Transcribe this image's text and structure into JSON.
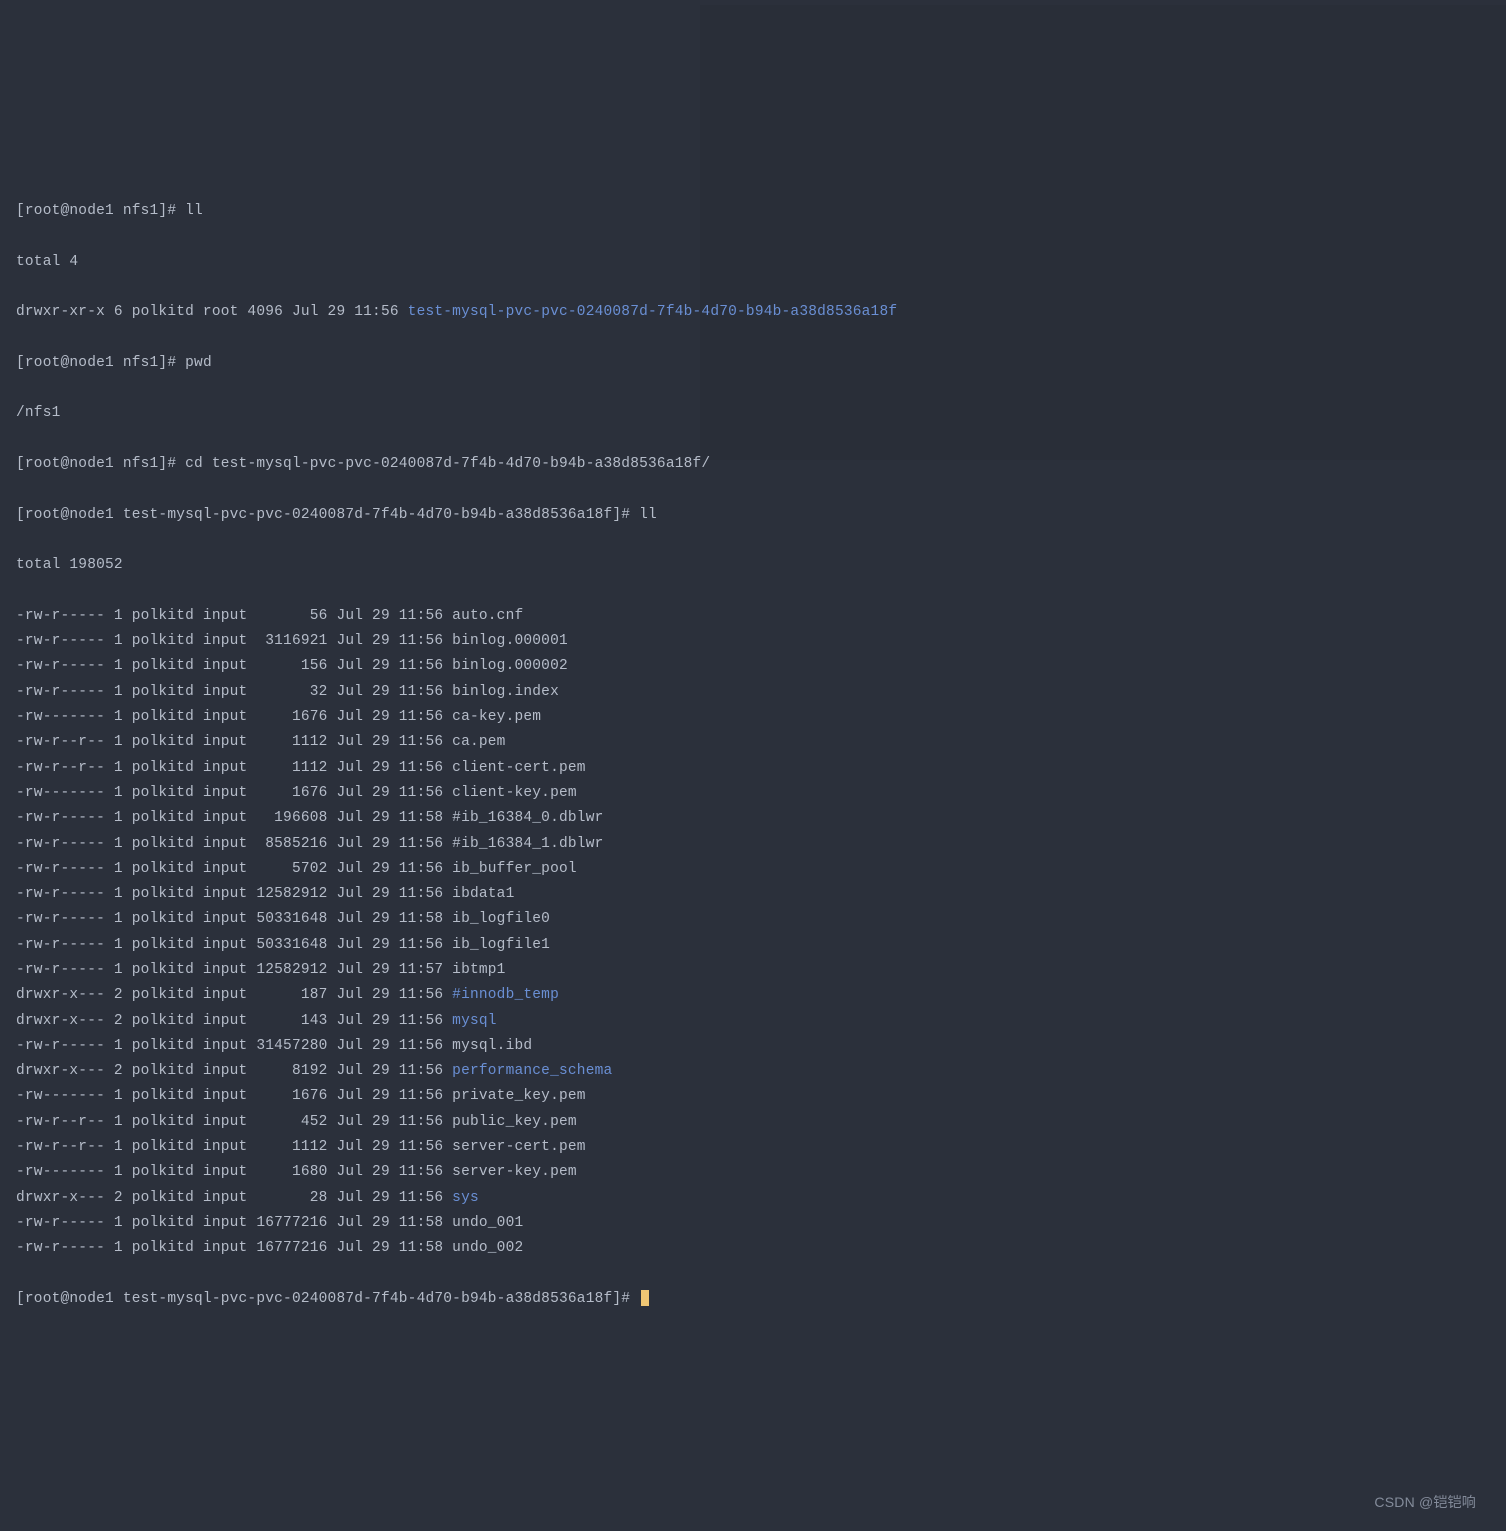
{
  "prompts": {
    "p1": "[root@node1 nfs1]# ",
    "p2": "[root@node1 test-mysql-pvc-pvc-0240087d-7f4b-4d70-b94b-a38d8536a18f]# "
  },
  "cmds": {
    "ll": "ll",
    "pwd": "pwd",
    "cd": "cd test-mysql-pvc-pvc-0240087d-7f4b-4d70-b94b-a38d8536a18f/"
  },
  "out": {
    "total1": "total 4",
    "pwd_out": "/nfs1",
    "total2": "total 198052",
    "dir1_prefix": "drwxr-xr-x 6 polkitd root 4096 Jul 29 11:56 ",
    "dir1_name": "test-mysql-pvc-pvc-0240087d-7f4b-4d70-b94b-a38d8536a18f"
  },
  "files": [
    {
      "perm": "-rw-r-----",
      "links": "1",
      "owner": "polkitd",
      "group": "input",
      "size": "56",
      "date": "Jul 29 11:56",
      "name": "auto.cnf",
      "dir": false
    },
    {
      "perm": "-rw-r-----",
      "links": "1",
      "owner": "polkitd",
      "group": "input",
      "size": "3116921",
      "date": "Jul 29 11:56",
      "name": "binlog.000001",
      "dir": false
    },
    {
      "perm": "-rw-r-----",
      "links": "1",
      "owner": "polkitd",
      "group": "input",
      "size": "156",
      "date": "Jul 29 11:56",
      "name": "binlog.000002",
      "dir": false
    },
    {
      "perm": "-rw-r-----",
      "links": "1",
      "owner": "polkitd",
      "group": "input",
      "size": "32",
      "date": "Jul 29 11:56",
      "name": "binlog.index",
      "dir": false
    },
    {
      "perm": "-rw-------",
      "links": "1",
      "owner": "polkitd",
      "group": "input",
      "size": "1676",
      "date": "Jul 29 11:56",
      "name": "ca-key.pem",
      "dir": false
    },
    {
      "perm": "-rw-r--r--",
      "links": "1",
      "owner": "polkitd",
      "group": "input",
      "size": "1112",
      "date": "Jul 29 11:56",
      "name": "ca.pem",
      "dir": false
    },
    {
      "perm": "-rw-r--r--",
      "links": "1",
      "owner": "polkitd",
      "group": "input",
      "size": "1112",
      "date": "Jul 29 11:56",
      "name": "client-cert.pem",
      "dir": false
    },
    {
      "perm": "-rw-------",
      "links": "1",
      "owner": "polkitd",
      "group": "input",
      "size": "1676",
      "date": "Jul 29 11:56",
      "name": "client-key.pem",
      "dir": false
    },
    {
      "perm": "-rw-r-----",
      "links": "1",
      "owner": "polkitd",
      "group": "input",
      "size": "196608",
      "date": "Jul 29 11:58",
      "name": "#ib_16384_0.dblwr",
      "dir": false
    },
    {
      "perm": "-rw-r-----",
      "links": "1",
      "owner": "polkitd",
      "group": "input",
      "size": "8585216",
      "date": "Jul 29 11:56",
      "name": "#ib_16384_1.dblwr",
      "dir": false
    },
    {
      "perm": "-rw-r-----",
      "links": "1",
      "owner": "polkitd",
      "group": "input",
      "size": "5702",
      "date": "Jul 29 11:56",
      "name": "ib_buffer_pool",
      "dir": false
    },
    {
      "perm": "-rw-r-----",
      "links": "1",
      "owner": "polkitd",
      "group": "input",
      "size": "12582912",
      "date": "Jul 29 11:56",
      "name": "ibdata1",
      "dir": false
    },
    {
      "perm": "-rw-r-----",
      "links": "1",
      "owner": "polkitd",
      "group": "input",
      "size": "50331648",
      "date": "Jul 29 11:58",
      "name": "ib_logfile0",
      "dir": false
    },
    {
      "perm": "-rw-r-----",
      "links": "1",
      "owner": "polkitd",
      "group": "input",
      "size": "50331648",
      "date": "Jul 29 11:56",
      "name": "ib_logfile1",
      "dir": false
    },
    {
      "perm": "-rw-r-----",
      "links": "1",
      "owner": "polkitd",
      "group": "input",
      "size": "12582912",
      "date": "Jul 29 11:57",
      "name": "ibtmp1",
      "dir": false
    },
    {
      "perm": "drwxr-x---",
      "links": "2",
      "owner": "polkitd",
      "group": "input",
      "size": "187",
      "date": "Jul 29 11:56",
      "name": "#innodb_temp",
      "dir": true
    },
    {
      "perm": "drwxr-x---",
      "links": "2",
      "owner": "polkitd",
      "group": "input",
      "size": "143",
      "date": "Jul 29 11:56",
      "name": "mysql",
      "dir": true
    },
    {
      "perm": "-rw-r-----",
      "links": "1",
      "owner": "polkitd",
      "group": "input",
      "size": "31457280",
      "date": "Jul 29 11:56",
      "name": "mysql.ibd",
      "dir": false
    },
    {
      "perm": "drwxr-x---",
      "links": "2",
      "owner": "polkitd",
      "group": "input",
      "size": "8192",
      "date": "Jul 29 11:56",
      "name": "performance_schema",
      "dir": true
    },
    {
      "perm": "-rw-------",
      "links": "1",
      "owner": "polkitd",
      "group": "input",
      "size": "1676",
      "date": "Jul 29 11:56",
      "name": "private_key.pem",
      "dir": false
    },
    {
      "perm": "-rw-r--r--",
      "links": "1",
      "owner": "polkitd",
      "group": "input",
      "size": "452",
      "date": "Jul 29 11:56",
      "name": "public_key.pem",
      "dir": false
    },
    {
      "perm": "-rw-r--r--",
      "links": "1",
      "owner": "polkitd",
      "group": "input",
      "size": "1112",
      "date": "Jul 29 11:56",
      "name": "server-cert.pem",
      "dir": false
    },
    {
      "perm": "-rw-------",
      "links": "1",
      "owner": "polkitd",
      "group": "input",
      "size": "1680",
      "date": "Jul 29 11:56",
      "name": "server-key.pem",
      "dir": false
    },
    {
      "perm": "drwxr-x---",
      "links": "2",
      "owner": "polkitd",
      "group": "input",
      "size": "28",
      "date": "Jul 29 11:56",
      "name": "sys",
      "dir": true
    },
    {
      "perm": "-rw-r-----",
      "links": "1",
      "owner": "polkitd",
      "group": "input",
      "size": "16777216",
      "date": "Jul 29 11:58",
      "name": "undo_001",
      "dir": false
    },
    {
      "perm": "-rw-r-----",
      "links": "1",
      "owner": "polkitd",
      "group": "input",
      "size": "16777216",
      "date": "Jul 29 11:58",
      "name": "undo_002",
      "dir": false
    }
  ],
  "watermark": "CSDN @铠铠响"
}
